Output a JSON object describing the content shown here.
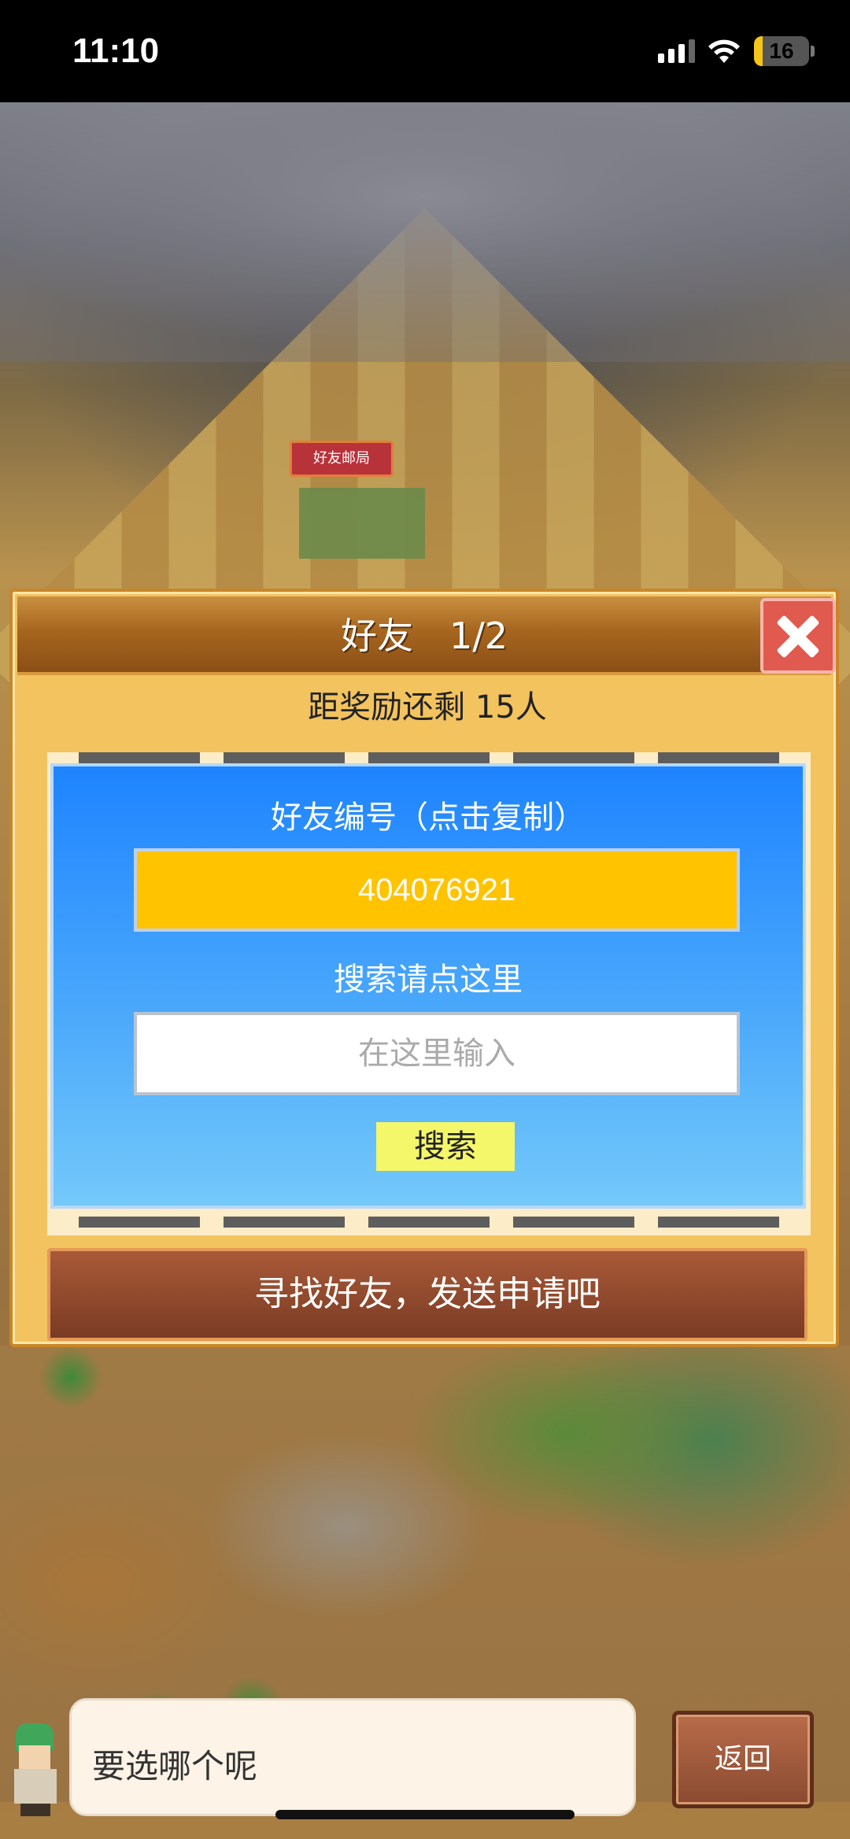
{
  "status_bar": {
    "time": "11:10",
    "battery_level": "16",
    "battery_fraction": 0.16,
    "icons": [
      "signal-icon",
      "wifi-icon",
      "battery-icon"
    ]
  },
  "map": {
    "building_label": "好友邮局"
  },
  "dialog": {
    "title": "好友　1/2",
    "reward_text": "距奖励还剩 15人",
    "friend_id_label": "好友编号（点击复制）",
    "friend_id": "404076921",
    "search_label": "搜索请点这里",
    "search_placeholder": "在这里输入",
    "search_button": "搜索",
    "find_button": "寻找好友，发送申请吧"
  },
  "bottom": {
    "speech": "要选哪个呢",
    "back_button": "返回"
  },
  "colors": {
    "header_brown": "#a7661f",
    "panel_blue": "#1e84ff",
    "id_box": "#ffc300",
    "search_button": "#f4f76a",
    "close_red": "#e05a4f"
  }
}
